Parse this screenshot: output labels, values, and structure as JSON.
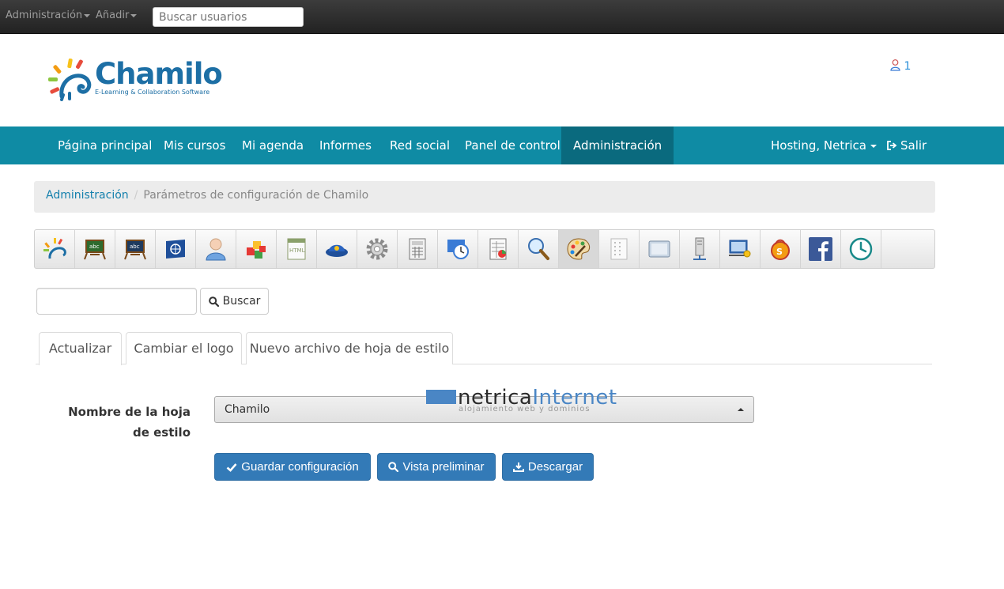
{
  "topbar": {
    "admin_menu": "Administración",
    "add_menu": "Añadir",
    "search_placeholder": "Buscar usuarios"
  },
  "header": {
    "logo_name": "Chamilo",
    "logo_tagline": "E-Learning & Collaboration Software",
    "user_count": "1"
  },
  "nav": {
    "items": [
      "Página principal",
      "Mis cursos",
      "Mi agenda",
      "Informes",
      "Red social",
      "Panel de control",
      "Administración"
    ],
    "user": "Hosting, Netrica",
    "logout": "Salir",
    "color": "#0f8ba4",
    "active_color": "#0a6a7e"
  },
  "breadcrumb": {
    "root": "Administración",
    "current": "Parámetros de configuración de Chamilo"
  },
  "toolbar": {
    "icons": [
      "chamilo-icon",
      "course-board-icon",
      "session-board-icon",
      "regional-icon",
      "user-icon",
      "plugins-icon",
      "editor-icon",
      "security-icon",
      "settings-gear-icon",
      "calculator-icon",
      "clock-globe-icon",
      "gradebook-icon",
      "search-icon",
      "stylesheets-palette-icon",
      "templates-icon",
      "window-icon",
      "server-icon",
      "ldap-icon",
      "shibboleth-icon",
      "facebook-icon",
      "timezone-clock-icon"
    ],
    "active_index": 13
  },
  "search": {
    "button": "Buscar"
  },
  "tabs": [
    "Actualizar",
    "Cambiar el logo",
    "Nuevo archivo de hoja de estilo"
  ],
  "form": {
    "label": "Nombre de la hoja de estilo",
    "selected": "Chamilo",
    "watermark_a": "netrica",
    "watermark_b": "Internet",
    "watermark_sub": "alojamiento web y dominios"
  },
  "buttons": {
    "save": "Guardar configuración",
    "preview": "Vista preliminar",
    "download": "Descargar",
    "color": "#337ab7"
  }
}
